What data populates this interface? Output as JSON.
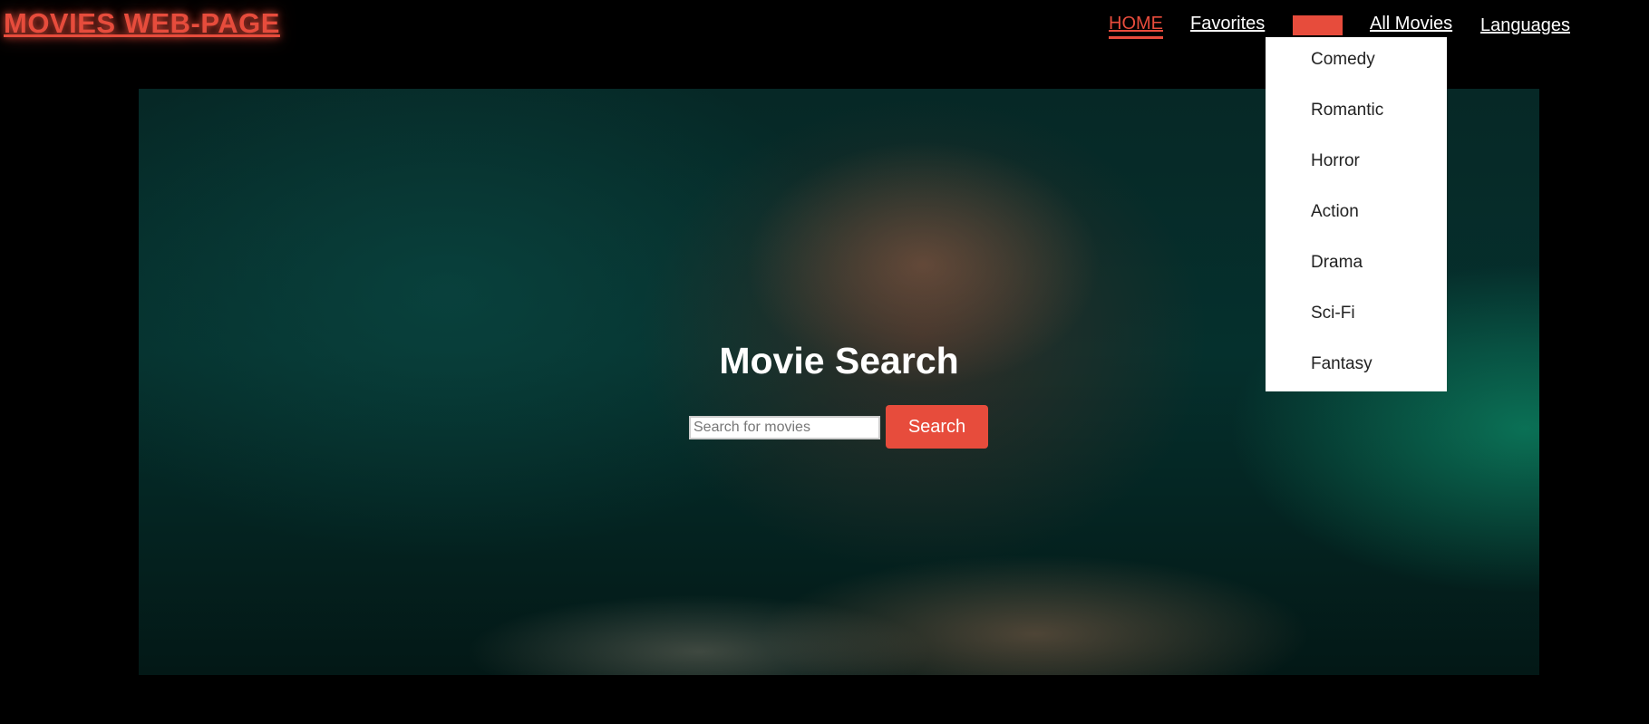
{
  "header": {
    "logo": "MOVIES WEB-PAGE",
    "nav": {
      "home": "HOME",
      "favorites": "Favorites",
      "all_movies": "All Movies",
      "languages": "Languages"
    },
    "genre_toggle": {
      "label": "",
      "color": "#e74c3c"
    }
  },
  "genres_dropdown": {
    "items": [
      "Comedy",
      "Romantic",
      "Horror",
      "Action",
      "Drama",
      "Sci-Fi",
      "Fantasy"
    ]
  },
  "hero": {
    "title": "Movie Search",
    "search": {
      "placeholder": "Search for movies",
      "value": "",
      "button_label": "Search"
    }
  },
  "colors": {
    "accent": "#e74c3c",
    "background": "#000000",
    "text": "#ffffff"
  }
}
